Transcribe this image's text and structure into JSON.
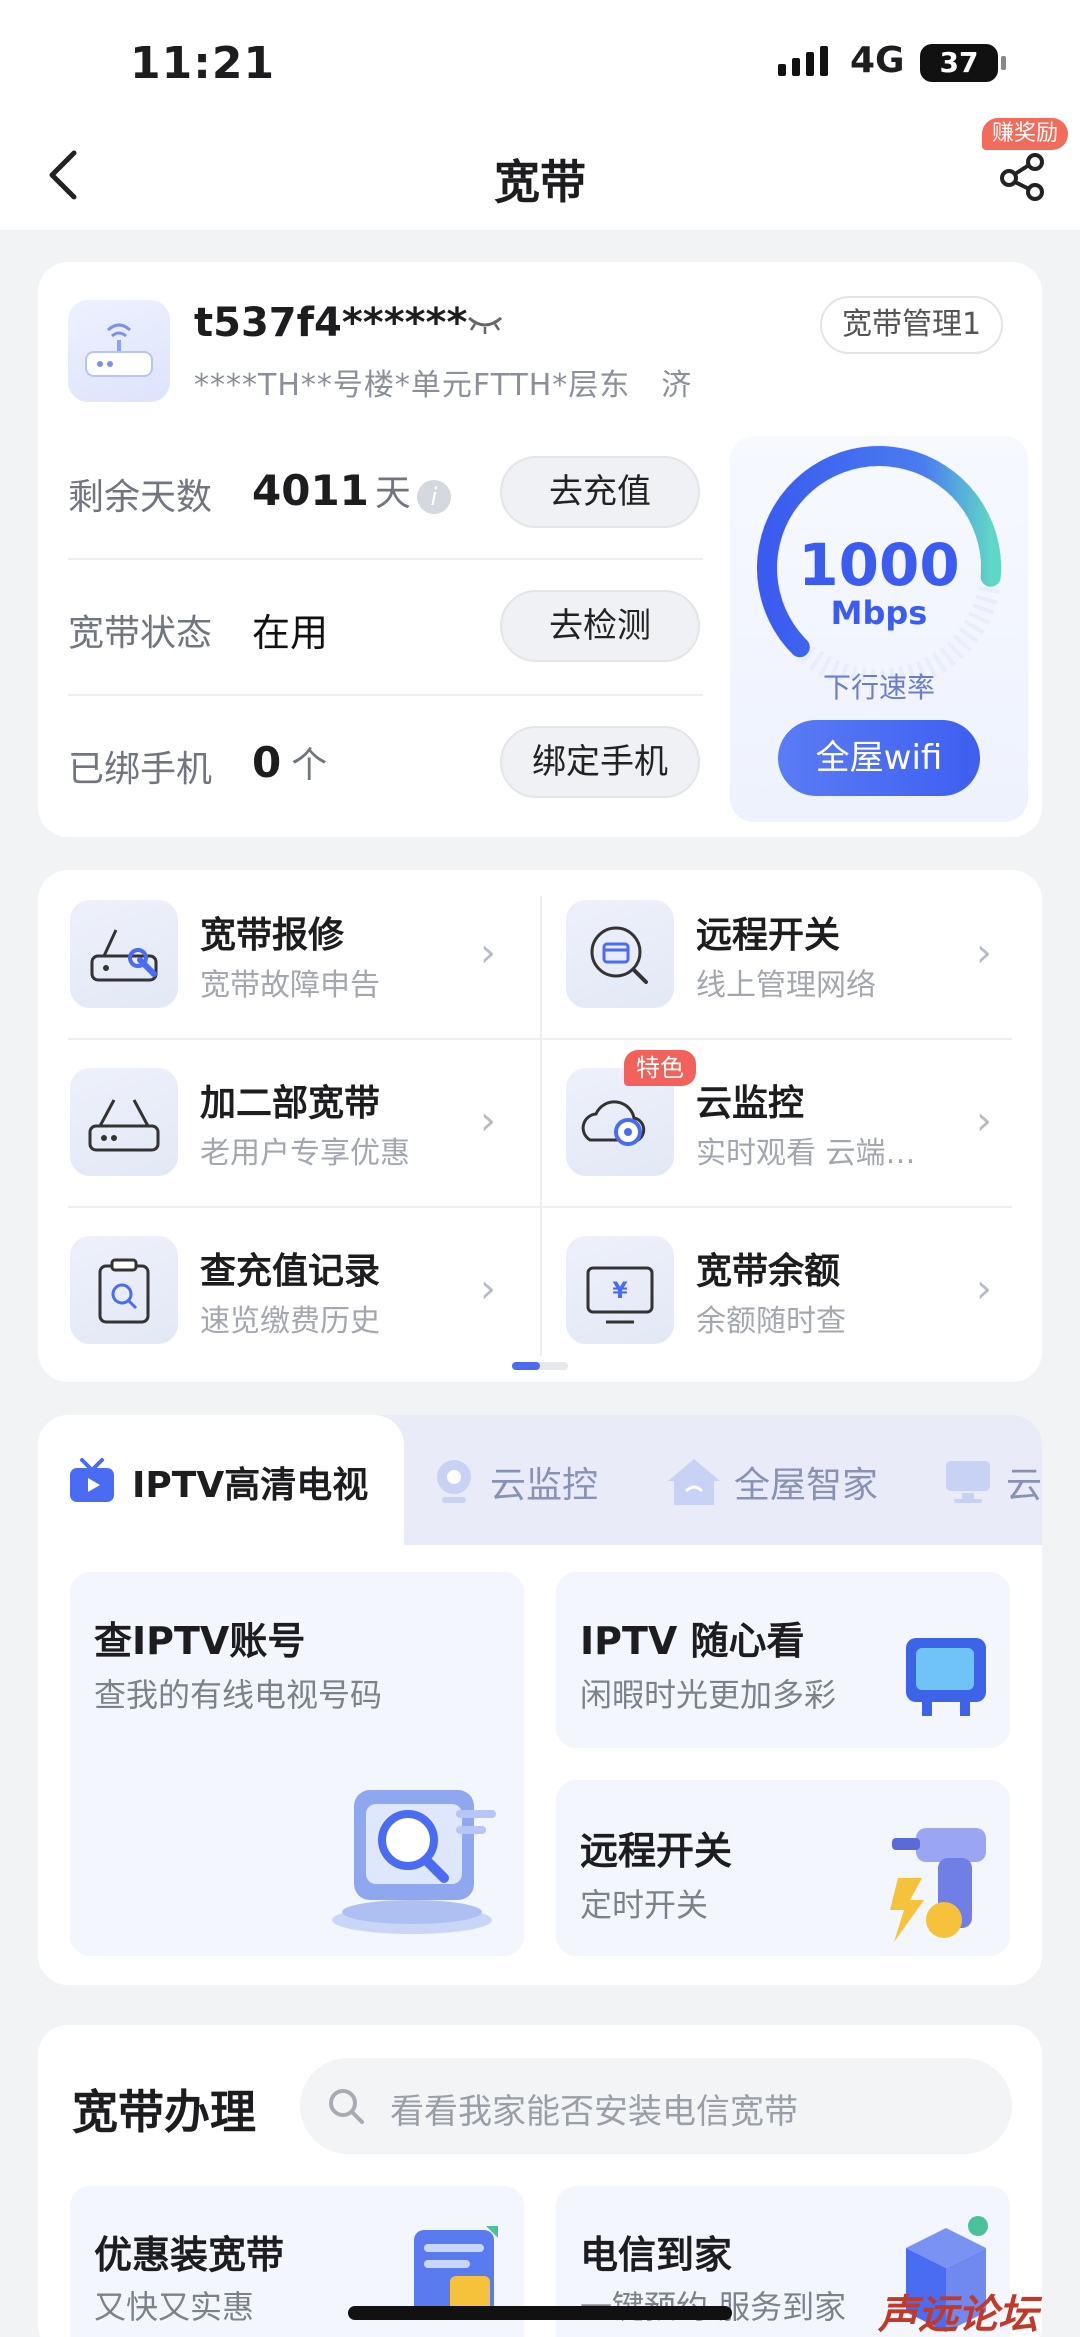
{
  "status_bar": {
    "time": "11:21",
    "network": "4G",
    "battery": "37"
  },
  "nav": {
    "title": "宽带",
    "reward_badge": "赚奖励"
  },
  "account": {
    "id": "t537f4******",
    "manage_label": "宽带管理1",
    "address": "****TH**号楼*单元FTTH*层东　济",
    "remaining_label": "剩余天数",
    "remaining_value": "4011",
    "remaining_unit": "天",
    "recharge_button": "去充值",
    "status_label": "宽带状态",
    "status_value": "在用",
    "check_button": "去检测",
    "phone_label": "已绑手机",
    "phone_value": "0",
    "phone_unit": "个",
    "bind_button": "绑定手机",
    "speed_value": "1000",
    "speed_unit": "Mbps",
    "speed_label": "下行速率",
    "wifi_button": "全屋wifi",
    "gauge_fraction": 0.85
  },
  "services": [
    {
      "title": "宽带报修",
      "sub": "宽带故障申告",
      "icon": "router-wrench-icon"
    },
    {
      "title": "远程开关",
      "sub": "线上管理网络",
      "icon": "calendar-search-icon"
    },
    {
      "title": "加二部宽带",
      "sub": "老用户专享优惠",
      "icon": "router-icon"
    },
    {
      "title": "云监控",
      "sub": "实时观看 云端…",
      "icon": "cloud-camera-icon",
      "tag": "特色"
    },
    {
      "title": "查充值记录",
      "sub": "速览缴费历史",
      "icon": "clipboard-search-icon"
    },
    {
      "title": "宽带余额",
      "sub": "余额随时查",
      "icon": "yen-monitor-icon"
    }
  ],
  "tabs": [
    {
      "label": "IPTV高清电视"
    },
    {
      "label": "云监控"
    },
    {
      "label": "全屋智家"
    },
    {
      "label": "云"
    }
  ],
  "iptv_tiles": [
    {
      "title": "查IPTV账号",
      "sub": "查我的有线电视号码"
    },
    {
      "title": "IPTV 随心看",
      "sub": "闲暇时光更加多彩"
    },
    {
      "title": "远程开关",
      "sub": "定时开关"
    }
  ],
  "broadband": {
    "title": "宽带办理",
    "search_placeholder": "看看我家能否安装电信宽带",
    "tiles": [
      {
        "title": "优惠装宽带",
        "sub": "又快又实惠"
      },
      {
        "title": "电信到家",
        "sub": "一键预约 服务到家"
      }
    ]
  },
  "watermark": "声远论坛",
  "colors": {
    "accent": "#4a6cf2",
    "tag_red": "#f2625a"
  }
}
